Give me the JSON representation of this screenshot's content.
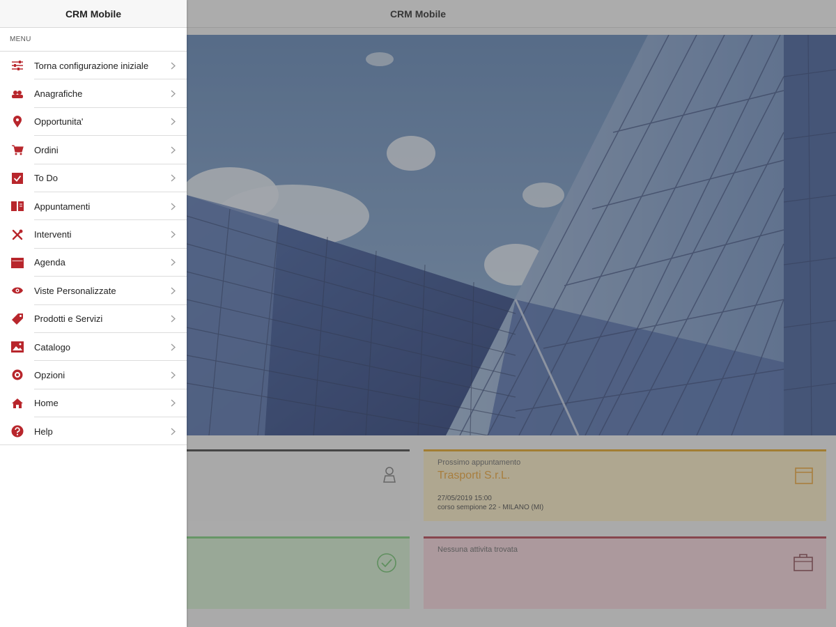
{
  "app": {
    "title": "CRM Mobile"
  },
  "menu": {
    "title": "CRM Mobile",
    "section_label": "MENU",
    "items": [
      {
        "label": "Torna configurazione iniziale",
        "icon": "sliders-icon"
      },
      {
        "label": "Anagrafiche",
        "icon": "contacts-icon"
      },
      {
        "label": "Opportunita'",
        "icon": "map-pin-icon"
      },
      {
        "label": "Ordini",
        "icon": "cart-icon"
      },
      {
        "label": "To Do",
        "icon": "checkbox-icon"
      },
      {
        "label": "Appuntamenti",
        "icon": "book-icon"
      },
      {
        "label": "Interventi",
        "icon": "tools-icon"
      },
      {
        "label": "Agenda",
        "icon": "calendar-icon"
      },
      {
        "label": "Viste Personalizzate",
        "icon": "eye-icon"
      },
      {
        "label": "Prodotti e Servizi",
        "icon": "tag-icon"
      },
      {
        "label": "Catalogo",
        "icon": "catalog-icon"
      },
      {
        "label": "Opzioni",
        "icon": "gear-icon"
      },
      {
        "label": "Home",
        "icon": "home-icon"
      },
      {
        "label": "Help",
        "icon": "help-icon"
      }
    ]
  },
  "dashboard": {
    "appointment_card": {
      "caption": "Prossimo appuntamento",
      "title": "Trasporti S.r.L.",
      "datetime": "27/05/2019 15:00",
      "address": "corso sempione 22 - MILANO (MI)"
    },
    "activity_card": {
      "caption": "Nessuna attivita trovata"
    }
  },
  "colors": {
    "accent": "#b8262c",
    "appointment": "#f0a431",
    "done": "#7bd07a",
    "activity": "#b43e4e"
  }
}
